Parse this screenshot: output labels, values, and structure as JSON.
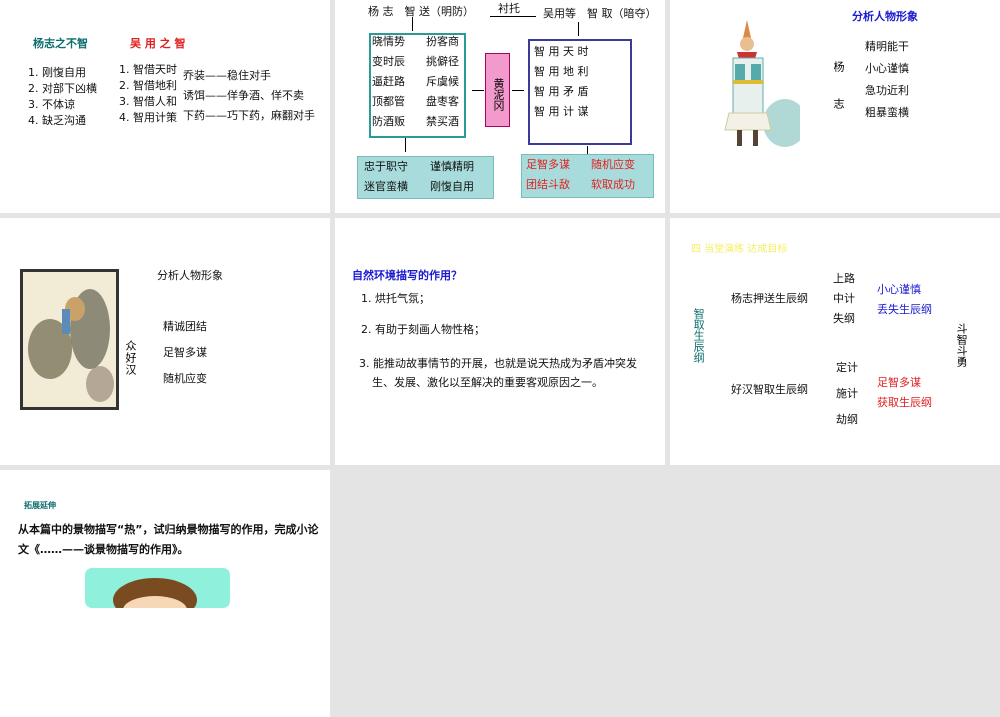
{
  "slides": [
    {
      "left_title": "杨志之不智",
      "right_title": "吴 用 之 智",
      "left_items": [
        "1. 刚愎自用",
        "2. 对部下凶横",
        "3. 不体谅",
        "4. 缺乏沟通"
      ],
      "right_items": [
        "1. 智借天时",
        "2. 智借地利",
        "3. 智借人和",
        "4. 智用计策"
      ],
      "tactics": [
        "乔装——稳住对手",
        "诱饵——佯争酒、佯不卖",
        "下药——巧下药，麻翻对手"
      ]
    },
    {
      "top_left": "杨 志　智 送（明防）",
      "relation": "衬托",
      "top_right": "吴用等　智 取（暗夺）",
      "left_box_a": [
        "晓情势",
        "变时辰",
        "逼赶路",
        "顶都管",
        "防酒贩"
      ],
      "left_box_b": [
        "扮客商",
        "挑僻径",
        "斥虞候",
        "盘枣客",
        "禁买酒"
      ],
      "center": "黄泥冈",
      "right_box": [
        "智 用 天 时",
        "智 用 地 利",
        "智 用 矛 盾",
        "智 用 计 谋"
      ],
      "left_result": [
        "忠于职守",
        "谨慎精明",
        "迷官蛮横",
        "刚愎自用"
      ],
      "right_result": [
        "足智多谋",
        "随机应变",
        "团结斗敌",
        "软取成功"
      ]
    },
    {
      "title": "分析人物形象",
      "name": "杨志",
      "traits": [
        "精明能干",
        "小心谨慎",
        "急功近利",
        "粗暴蛮横"
      ]
    },
    {
      "title": "分析人物形象",
      "name": "众好汉",
      "traits": [
        "精诚团结",
        "足智多谋",
        "随机应变"
      ]
    },
    {
      "question": "自然环境描写的作用？",
      "items": [
        "1. 烘托气氛；",
        "2. 有助于刻画人物性格；",
        "3. 能推动故事情节的开展，也就是说天热成为矛盾冲突发",
        "生、发展、激化以至解决的重要客观原因之一。"
      ]
    },
    {
      "heading": "四  当堂演练  达成目标",
      "side": "智取生辰纲",
      "row1": "杨志押送生辰纲",
      "row1_steps": [
        "上路",
        "中计",
        "失纲"
      ],
      "row1_result": [
        "小心谨慎",
        "丢失生辰纲"
      ],
      "row2": "好汉智取生辰纲",
      "row2_steps": [
        "定计",
        "施计",
        "劫纲"
      ],
      "row2_result": [
        "足智多谋",
        "获取生辰纲"
      ],
      "right": "斗智斗勇"
    },
    {
      "heading": "拓展延伸",
      "body_line1": "从本篇中的景物描写“热”，试归纳景物描写的作用，完成小论",
      "body_line2": "文《……——谈景物描写的作用》。"
    }
  ]
}
